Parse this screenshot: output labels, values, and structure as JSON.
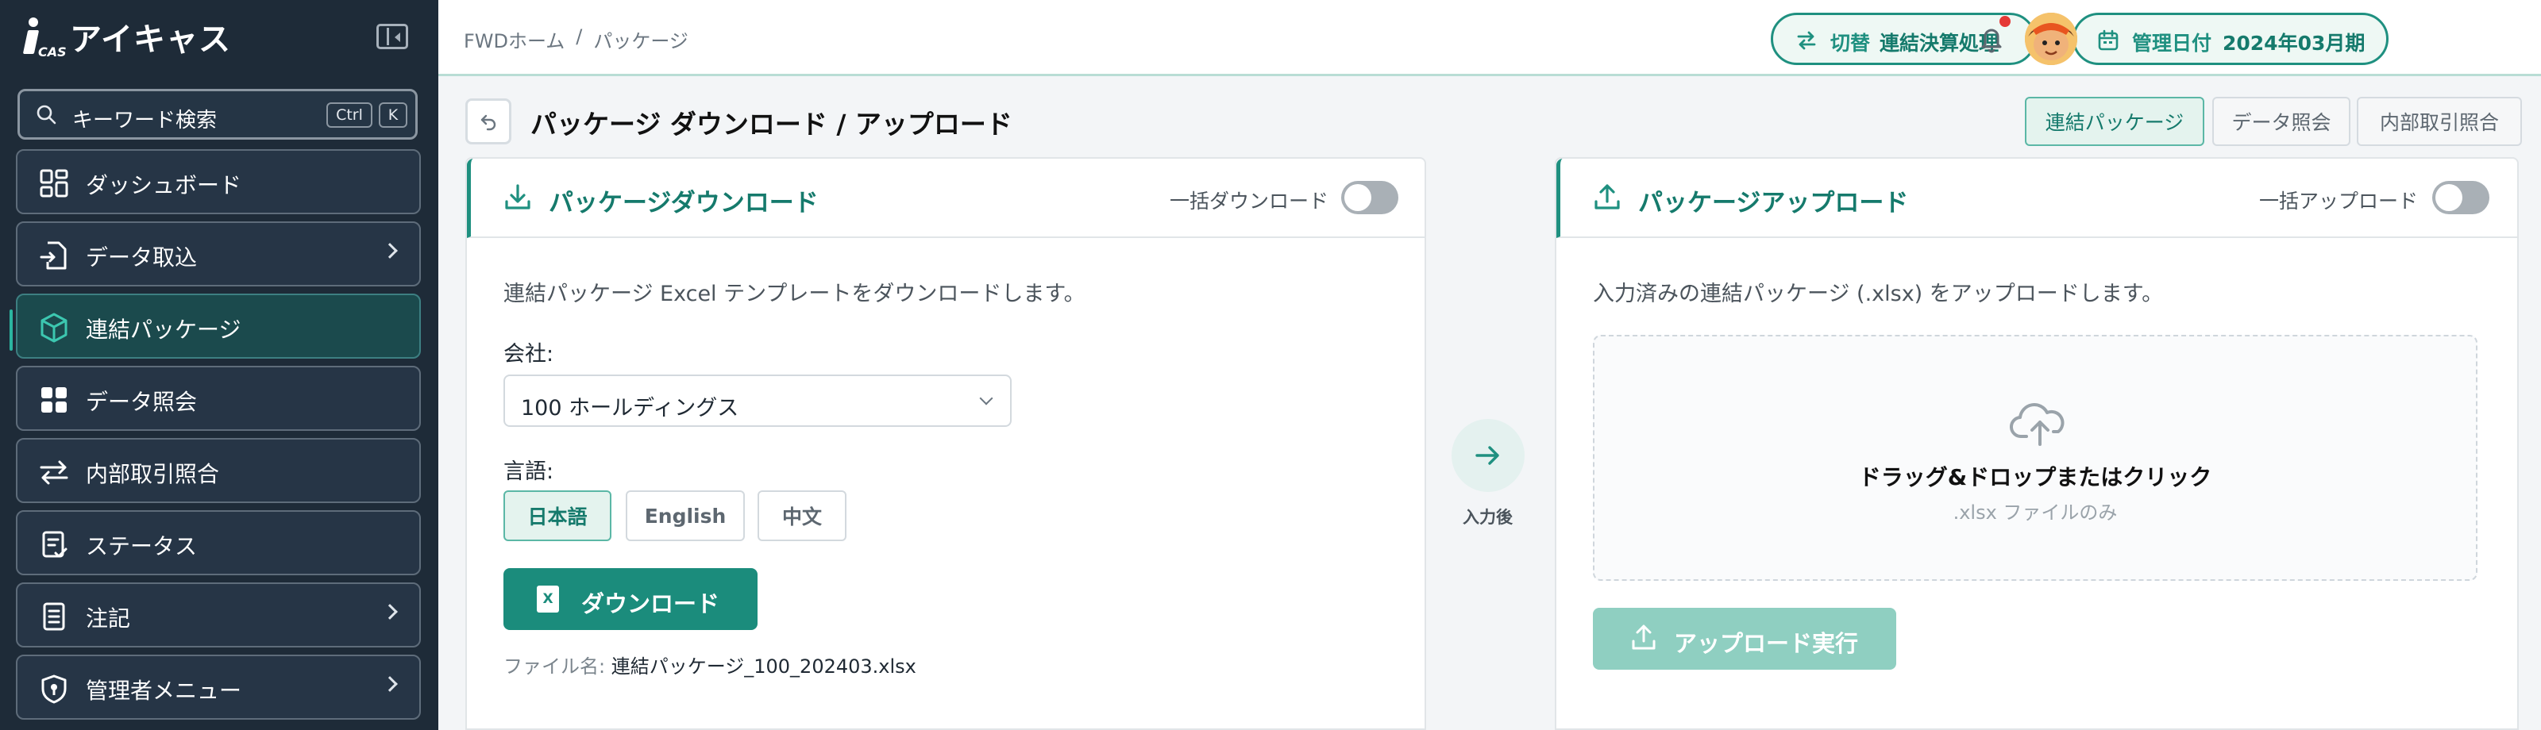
{
  "app": {
    "name": "アイキャス",
    "logo_sub": "CAS"
  },
  "search": {
    "label": "キーワード検索",
    "kbd_ctrl": "Ctrl",
    "kbd_k": "K"
  },
  "sidebar": {
    "items": [
      {
        "label": "ダッシュボード",
        "icon": "dashboard-icon",
        "chevron": false,
        "active": false
      },
      {
        "label": "データ取込",
        "icon": "file-import-icon",
        "chevron": true,
        "active": false
      },
      {
        "label": "連結パッケージ",
        "icon": "package-icon",
        "chevron": false,
        "active": true
      },
      {
        "label": "データ照会",
        "icon": "table-icon",
        "chevron": false,
        "active": false
      },
      {
        "label": "内部取引照合",
        "icon": "swap-icon",
        "chevron": false,
        "active": false
      },
      {
        "label": "ステータス",
        "icon": "clipboard-check-icon",
        "chevron": false,
        "active": false
      },
      {
        "label": "注記",
        "icon": "note-icon",
        "chevron": true,
        "active": false
      },
      {
        "label": "管理者メニュー",
        "icon": "shield-icon",
        "chevron": true,
        "active": false
      }
    ]
  },
  "header": {
    "breadcrumb": [
      "FWDホーム",
      "/",
      "パッケージ"
    ],
    "switch_btn": {
      "prefix": "切替",
      "label": "連結決算処理"
    },
    "date_btn": {
      "prefix": "管理日付",
      "label": "2024年03月期"
    }
  },
  "page": {
    "title": "パッケージ ダウンロード / アップロード",
    "tabs": [
      "連結パッケージ",
      "データ照会",
      "内部取引照合"
    ],
    "active_tab": 0
  },
  "download": {
    "title": "パッケージダウンロード",
    "bulk_label": "一括ダウンロード",
    "bulk_on": false,
    "description": "連結パッケージ Excel テンプレートをダウンロードします。",
    "company_label": "会社:",
    "company_value": "100 ホールディングス",
    "language_label": "言語:",
    "languages": [
      "日本語",
      "English",
      "中文"
    ],
    "selected_language": 0,
    "button_label": "ダウンロード",
    "filename_label": "ファイル名:",
    "filename_value": "連結パッケージ_100_202403.xlsx"
  },
  "middle": {
    "label": "入力後"
  },
  "upload": {
    "title": "パッケージアップロード",
    "bulk_label": "一括アップロード",
    "bulk_on": false,
    "description": "入力済みの連結パッケージ (.xlsx) をアップロードします。",
    "dropzone_main": "ドラッグ&ドロップまたはクリック",
    "dropzone_sub": ".xlsx ファイルのみ",
    "button_label": "アップロード実行"
  },
  "colors": {
    "accent": "#1b8c7c",
    "sidebar_bg": "#1e2b38",
    "notification": "#e53935"
  }
}
